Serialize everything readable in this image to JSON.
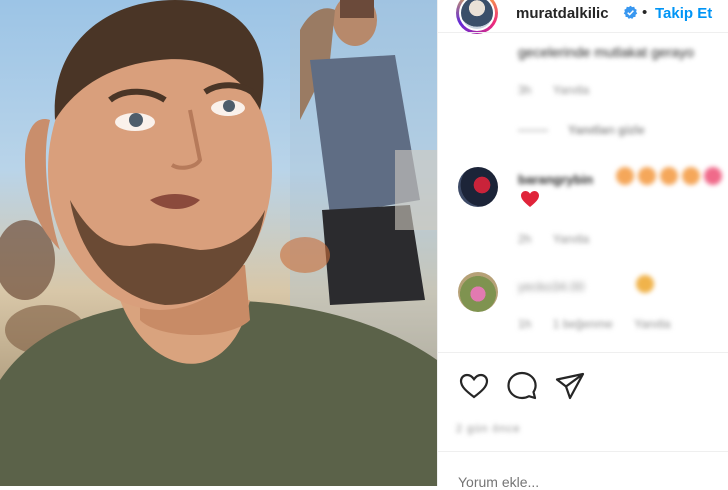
{
  "post": {
    "username": "muratdalkilic",
    "verified": true,
    "separator": "•",
    "follow_label": "Takip Et",
    "accent_color": "#0095f6"
  },
  "comments": {
    "partial_text": "gecelerinde mutlakat gerayo",
    "first_meta": {
      "time": "3h",
      "reply_label": "Yanıtla"
    },
    "hide_replies_label": "Yanıtları gizle",
    "items": [
      {
        "username": "barangrybin",
        "meta": {
          "time": "2h",
          "reply_label": "Yanıtla"
        }
      },
      {
        "username": "yecko34.00",
        "meta": {
          "time": "1h",
          "likes_label": "1 beğenme",
          "reply_label": "Yanıtla"
        }
      }
    ]
  },
  "likes_text": "2 gün önce",
  "add_comment_placeholder": "Yorum ekle...",
  "icons": [
    "heart-icon",
    "comment-icon",
    "share-icon",
    "verified-icon"
  ]
}
